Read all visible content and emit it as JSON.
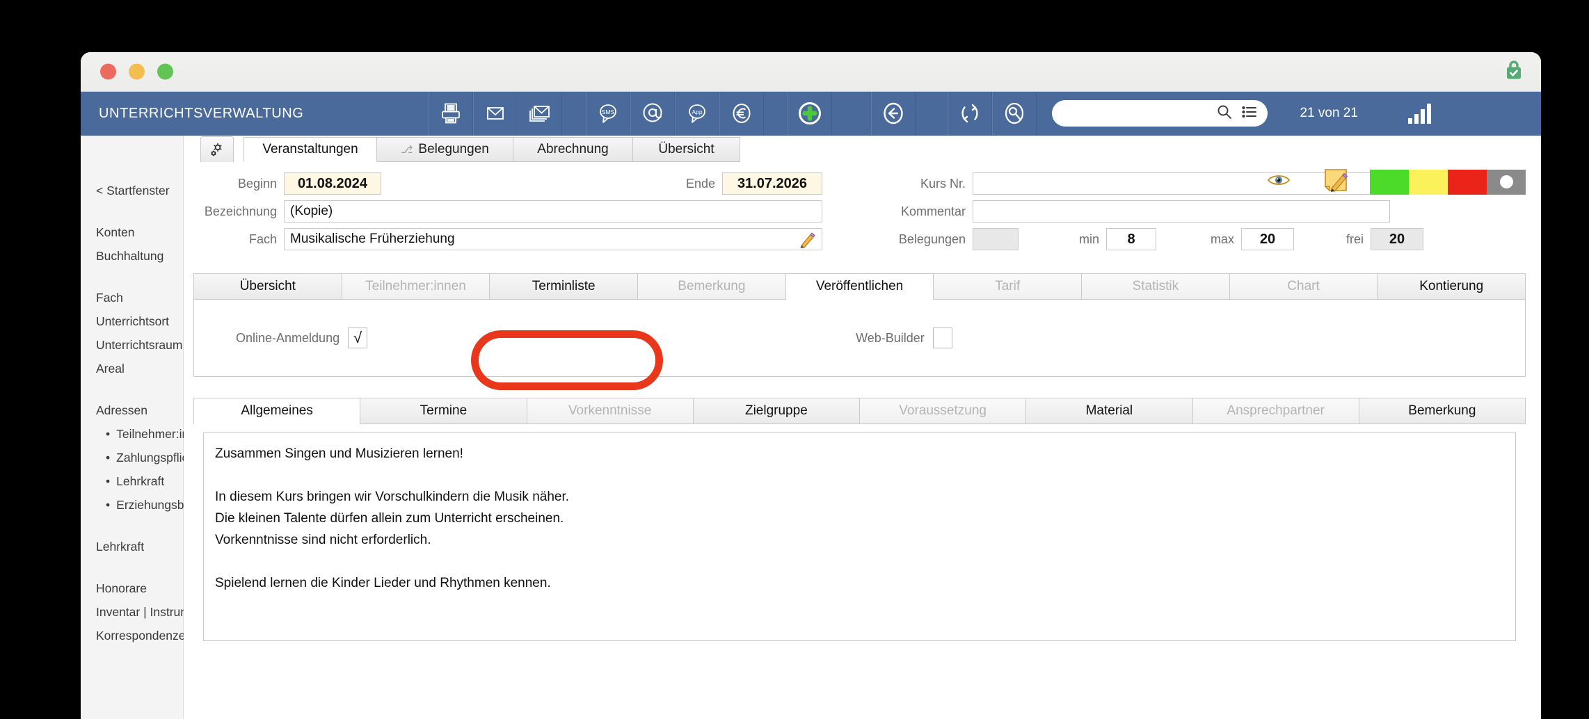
{
  "window": {
    "traffic_lights": [
      "close",
      "minimize",
      "zoom"
    ],
    "lock_icon": "green-lock-icon"
  },
  "toolbar": {
    "app_title": "UNTERRICHTSVERWALTUNG",
    "icons": [
      {
        "name": "printer-icon",
        "label": "Drucken"
      },
      {
        "name": "mail-icon",
        "label": "E-Mail"
      },
      {
        "name": "mail-serial-icon",
        "label": "Serienmail"
      },
      {
        "name": "sms-bubble-icon",
        "label": "SMS"
      },
      {
        "name": "at-sign-icon",
        "label": "@"
      },
      {
        "name": "app-bubble-icon",
        "label": "App"
      },
      {
        "name": "euro-icon",
        "label": "€"
      },
      {
        "name": "plus-circle-icon",
        "label": "Neu"
      },
      {
        "name": "back-arrow-icon",
        "label": "Zurück"
      },
      {
        "name": "refresh-icon",
        "label": "Aktualisieren"
      },
      {
        "name": "search-person-icon",
        "label": "Suchen"
      }
    ],
    "search": {
      "value": "",
      "placeholder": "",
      "icons": [
        "search-icon",
        "list-icon"
      ]
    },
    "record_count": "21 von 21",
    "chart_icon": "bar-chart-icon"
  },
  "sidebar": {
    "back_link": "< Startfenster",
    "groups": [
      {
        "items": [
          "Konten",
          "Buchhaltung"
        ]
      },
      {
        "items": [
          "Fach",
          "Unterrichtsort",
          "Unterrichtsraum",
          "Areal"
        ]
      },
      {
        "items": [
          "Adressen"
        ],
        "sub": [
          "Teilnehmer:in",
          "Zahlungspflichtige:r",
          "Lehrkraft",
          "Erziehungsber."
        ]
      },
      {
        "items": [
          "Lehrkraft"
        ]
      },
      {
        "items": [
          "Honorare",
          "Inventar | Instrum.",
          "Korrespondenzen"
        ]
      }
    ]
  },
  "form_tabs": {
    "gear_icon": "gear-icon",
    "items": [
      {
        "label": "Veranstaltungen",
        "active": true,
        "icon": ""
      },
      {
        "label": "Belegungen",
        "active": false,
        "icon": "⎇"
      },
      {
        "label": "Abrechnung",
        "active": false,
        "icon": ""
      },
      {
        "label": "Übersicht",
        "active": false,
        "icon": ""
      }
    ]
  },
  "header": {
    "beginn_label": "Beginn",
    "beginn_value": "01.08.2024",
    "ende_label": "Ende",
    "ende_value": "31.07.2026",
    "bezeichnung_label": "Bezeichnung",
    "bezeichnung_value": "(Kopie)",
    "fach_label": "Fach",
    "fach_value": "Musikalische Früherziehung",
    "fach_edit_icon": "pencil-icon",
    "kursnr_label": "Kurs Nr.",
    "kursnr_value": "",
    "kommentar_label": "Kommentar",
    "kommentar_value": "",
    "belegungen_label": "Belegungen",
    "belegungen_value": "",
    "min_label": "min",
    "min_value": "8",
    "max_label": "max",
    "max_value": "20",
    "frei_label": "frei",
    "frei_value": "20",
    "eye_icon": "eye-icon",
    "note_icon": "note-edit-icon",
    "status_lights": [
      "#4ddb2a",
      "#fbf15a",
      "#eb2419",
      "#8a8a8a"
    ]
  },
  "main_tabs": [
    {
      "label": "Übersicht",
      "state": "normal"
    },
    {
      "label": "Teilnehmer:innen",
      "state": "disabled"
    },
    {
      "label": "Terminliste",
      "state": "normal"
    },
    {
      "label": "Bemerkung",
      "state": "disabled"
    },
    {
      "label": "Veröffentlichen",
      "state": "active"
    },
    {
      "label": "Tarif",
      "state": "disabled"
    },
    {
      "label": "Statistik",
      "state": "disabled"
    },
    {
      "label": "Chart",
      "state": "disabled"
    },
    {
      "label": "Kontierung",
      "state": "normal"
    }
  ],
  "publish_panel": {
    "online_label": "Online-Anmeldung",
    "online_checked": "√",
    "webbuilder_label": "Web-Builder",
    "webbuilder_checked": ""
  },
  "sub_tabs": [
    {
      "label": "Allgemeines",
      "state": "active"
    },
    {
      "label": "Termine",
      "state": "normal"
    },
    {
      "label": "Vorkenntnisse",
      "state": "disabled"
    },
    {
      "label": "Zielgruppe",
      "state": "normal"
    },
    {
      "label": "Voraussetzung",
      "state": "disabled"
    },
    {
      "label": "Material",
      "state": "normal"
    },
    {
      "label": "Ansprechpartner",
      "state": "disabled"
    },
    {
      "label": "Bemerkung",
      "state": "normal"
    }
  ],
  "description": "Zusammen Singen und Musizieren lernen!\n\nIn diesem Kurs bringen wir Vorschulkindern die Musik näher.\nDie kleinen Talente dürfen allein zum Unterricht erscheinen.\nVorkenntnisse sind nicht erforderlich.\n\nSpielend lernen die Kinder Lieder und Rhythmen kennen.",
  "colors": {
    "toolbar_blue": "#4a6a9c",
    "annotation_red": "#e8371b",
    "date_field_bg": "#fdf7e3"
  }
}
